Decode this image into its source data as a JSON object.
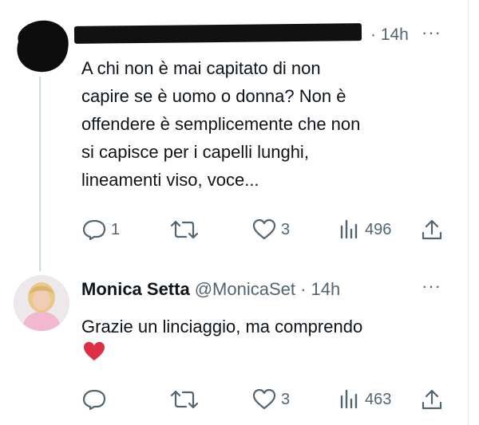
{
  "tweet1": {
    "time": "· 14h",
    "more": "···",
    "text": "A chi non è mai capitato di non\ncapire se è uomo o donna? Non è\noffendere è semplicemente che non\nsi capisce per i capelli lunghi,\nlineamenti viso, voce...",
    "actions": {
      "reply_icon": "reply-icon",
      "reply_count": "1",
      "retweet_icon": "retweet-icon",
      "retweet_count": "",
      "like_icon": "heart-icon",
      "like_count": "3",
      "views_icon": "views-icon",
      "views_count": "496",
      "share_icon": "share-icon"
    }
  },
  "tweet2": {
    "author_name": "Monica Setta",
    "author_handle": "@MonicaSet · 14h",
    "more": "···",
    "text": "Grazie un linciaggio, ma comprendo",
    "emoji": "red-heart-emoji",
    "actions": {
      "reply_icon": "reply-icon",
      "reply_count": "",
      "retweet_icon": "retweet-icon",
      "retweet_count": "",
      "like_icon": "heart-icon",
      "like_count": "3",
      "views_icon": "views-icon",
      "views_count": "463",
      "share_icon": "share-icon"
    }
  },
  "colors": {
    "text": "#0f1419",
    "secondary": "#536471",
    "thread_line": "#cfd9de",
    "heart_red": "#dd2e44"
  }
}
